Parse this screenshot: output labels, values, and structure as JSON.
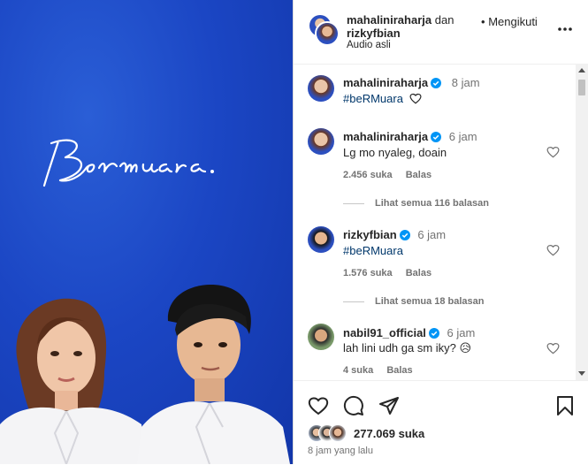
{
  "post": {
    "script_title": "Bermuara."
  },
  "header": {
    "user1": "mahaliniraharja",
    "connector": "dan",
    "user2": "rizkyfbian",
    "audio": "Audio asli",
    "follow_label": "Mengikuti",
    "more_icon": "more-horizontal-icon"
  },
  "caption": {
    "user": "mahaliniraharja",
    "time": "8 jam",
    "text": "#beRMuara"
  },
  "comments": [
    {
      "user": "mahaliniraharja",
      "time": "6 jam",
      "text": "Lg mo nyaleg, doain",
      "likes": "2.456 suka",
      "reply": "Balas",
      "view_replies": "Lihat semua 116 balasan"
    },
    {
      "user": "rizkyfbian",
      "time": "6 jam",
      "text": "#beRMuara",
      "likes": "1.576 suka",
      "reply": "Balas",
      "view_replies": "Lihat semua 18 balasan"
    },
    {
      "user": "nabil91_official",
      "time": "6 jam",
      "text": "lah lini udh ga sm iky? 😥",
      "likes": "4 suka",
      "reply": "Balas"
    }
  ],
  "footer": {
    "likes": "277.069 suka",
    "time": "8 jam yang lalu"
  },
  "colors": {
    "verified": "#0095f6",
    "bg_blue": "#1b46c4"
  }
}
